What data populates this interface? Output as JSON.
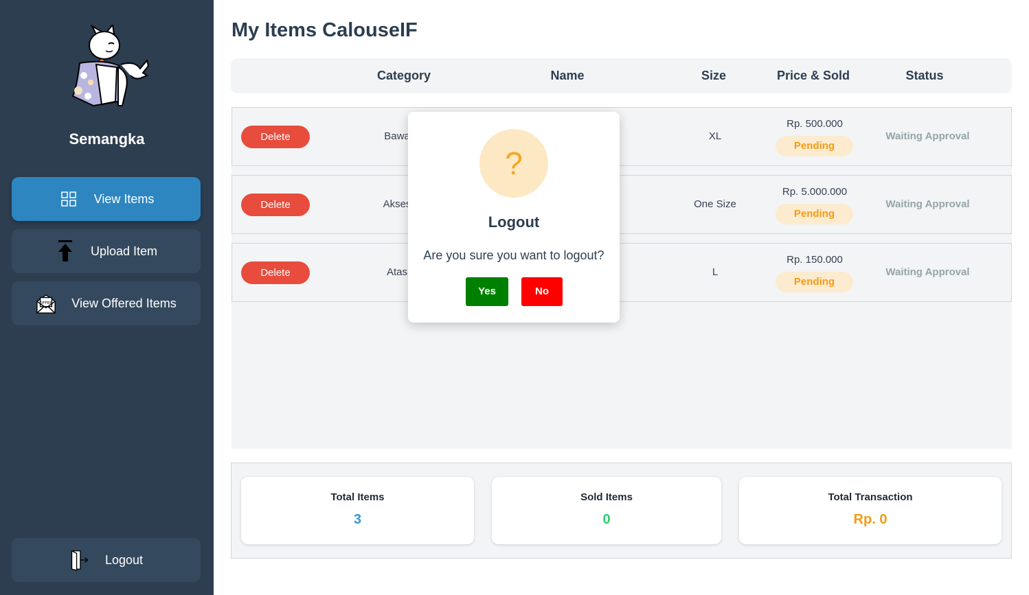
{
  "sidebar": {
    "user_name": "Semangka",
    "nav": {
      "view_items": "View Items",
      "upload_item": "Upload Item",
      "view_offered_items": "View Offered Items",
      "logout": "Logout"
    },
    "icons": {
      "view_items": "grid-icon",
      "upload_item": "upload-arrow-icon",
      "view_offered_items": "offer-envelope-icon",
      "logout": "logout-door-icon"
    }
  },
  "main": {
    "title": "My Items CalouseIF",
    "headers": {
      "category": "Category",
      "name": "Name",
      "size": "Size",
      "price_sold": "Price & Sold",
      "status": "Status"
    },
    "rows": [
      {
        "delete_label": "Delete",
        "category": "Bawa",
        "size": "XL",
        "price": "Rp. 500.000",
        "sold_status": "Pending",
        "status": "Waiting Approval"
      },
      {
        "delete_label": "Delete",
        "category": "Akses",
        "size": "One Size",
        "price": "Rp. 5.000.000",
        "sold_status": "Pending",
        "status": "Waiting Approval"
      },
      {
        "delete_label": "Delete",
        "category": "Atas",
        "size": "L",
        "price": "Rp. 150.000",
        "sold_status": "Pending",
        "status": "Waiting Approval"
      }
    ]
  },
  "summary": {
    "total_items": {
      "label": "Total Items",
      "value": "3"
    },
    "sold_items": {
      "label": "Sold Items",
      "value": "0"
    },
    "total_transaction": {
      "label": "Total Transaction",
      "value": "Rp. 0"
    }
  },
  "modal": {
    "icon": "?",
    "title": "Logout",
    "message": "Are you sure you want to logout?",
    "yes_label": "Yes",
    "no_label": "No"
  },
  "colors": {
    "sidebar": "#2c3e50",
    "active_nav": "#2e86c1",
    "delete": "#e74c3c",
    "pending": "#f39c12",
    "total_items_value": "#3498db",
    "sold_items_value": "#2ecc71",
    "total_transaction_value": "#f39c12",
    "yes": "#008000",
    "no": "#ff0000"
  }
}
